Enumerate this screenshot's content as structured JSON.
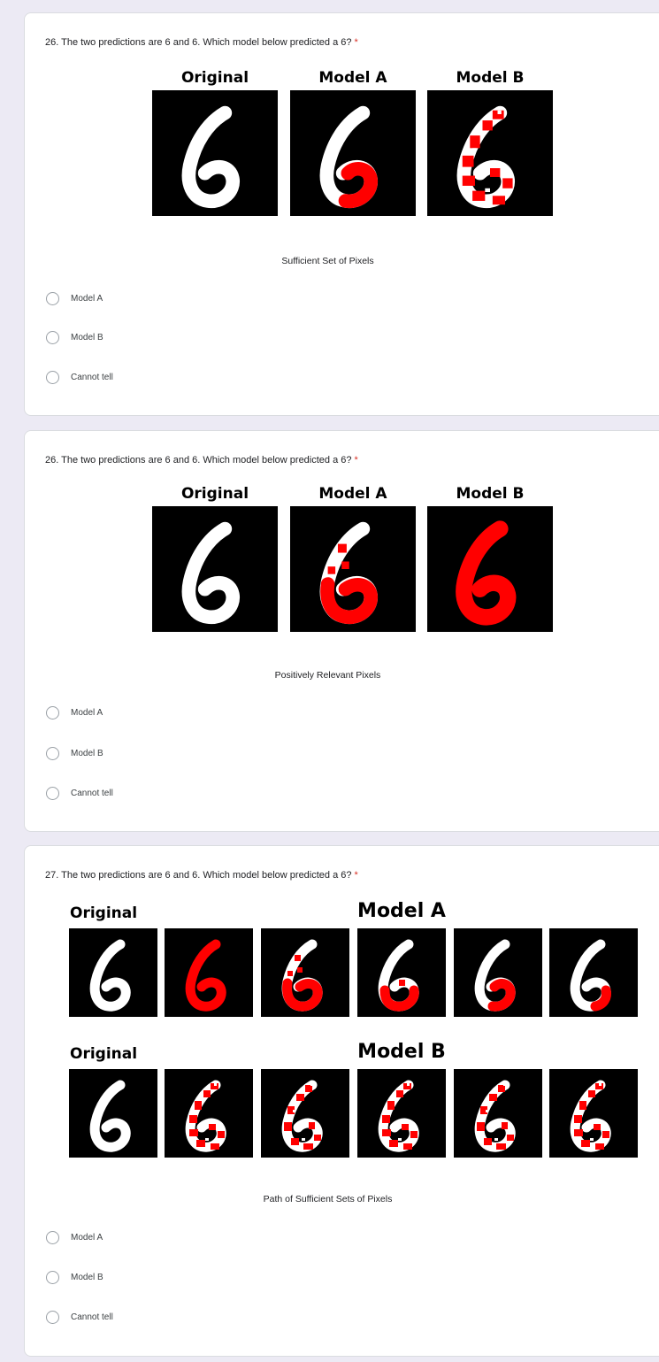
{
  "questions": [
    {
      "title": "26. The two predictions are 6 and 6. Which model below predicted a 6?",
      "required_mark": "*",
      "figure_headers": [
        "Original",
        "Model A",
        "Model B"
      ],
      "caption": "Sufficient Set of Pixels",
      "options": [
        "Model A",
        "Model B",
        "Cannot tell"
      ]
    },
    {
      "title": "26. The two predictions are 6 and 6. Which model below predicted a 6?",
      "required_mark": "*",
      "figure_headers": [
        "Original",
        "Model A",
        "Model B"
      ],
      "caption": "Positively Relevant Pixels",
      "options": [
        "Model A",
        "Model B",
        "Cannot tell"
      ]
    },
    {
      "title": "27. The two predictions are 6 and 6. Which model below predicted a 6?",
      "required_mark": "*",
      "figure_headers": [
        "Original",
        "Model A",
        "Original",
        "Model B"
      ],
      "caption": "Path of Sufficient Sets of Pixels",
      "options": [
        "Model A",
        "Model B",
        "Cannot tell"
      ]
    }
  ],
  "colors": {
    "page_background": "#eceaf4",
    "card_background": "#ffffff",
    "required_asterisk": "#d93025",
    "highlight_pixels": "#ff0000",
    "digit_stroke": "#ffffff"
  }
}
